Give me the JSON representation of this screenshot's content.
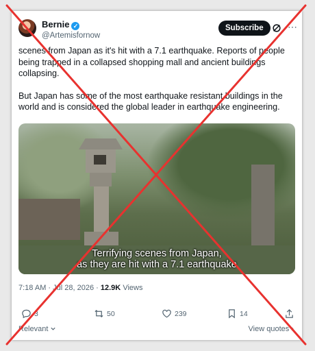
{
  "author": {
    "display_name": "Bernie",
    "handle": "@Artemisfornow",
    "verified_icon": "✓"
  },
  "header": {
    "subscribe_label": "Subscribe",
    "more_label": "⋯"
  },
  "post": {
    "paragraphs": [
      "scenes from Japan as it's hit with a 7.1 earthquake. Reports of people being trapped in a collapsed shopping mall and ancient buildings collapsing.",
      "But Japan has some of the most earthquake resistant buildings in the world and is considered the global leader in earthquake engineering."
    ]
  },
  "media": {
    "caption_line1": "Terrifying scenes from Japan,",
    "caption_line2": "as they are hit with a 7.1 earthquake"
  },
  "meta": {
    "time": "7:18 AM",
    "separator": "·",
    "date": "Jul 28, 2026",
    "views_count": "12.9K",
    "views_label": "Views"
  },
  "actions": {
    "replies": "3",
    "reposts": "50",
    "likes": "239",
    "bookmarks": "14"
  },
  "footer": {
    "relevant_label": "Relevant",
    "view_quotes_label": "View quotes",
    "view_quotes_arrow": "›"
  },
  "colors": {
    "x_mark": "#e8322f",
    "accent": "#1d9bf0"
  }
}
